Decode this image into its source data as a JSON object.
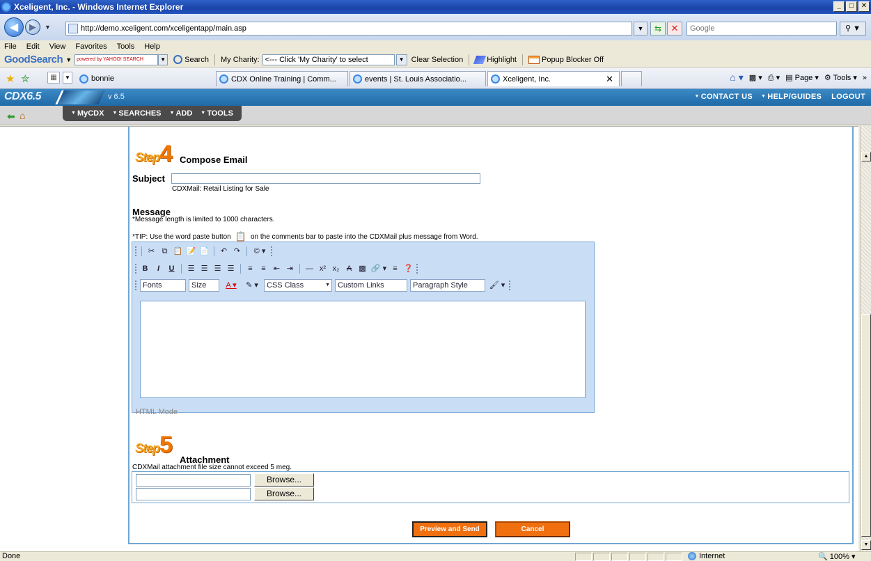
{
  "browser": {
    "window_title": "Xceligent, Inc. - Windows Internet Explorer",
    "url": "http://demo.xceligent.com/xceligentapp/main.asp",
    "search_placeholder": "Google",
    "menu": [
      "File",
      "Edit",
      "View",
      "Favorites",
      "Tools",
      "Help"
    ],
    "goodsearch": {
      "logo": "GoodSearch",
      "powered": "powered by YAHOO! SEARCH",
      "search_label": "Search",
      "charity_label": "My Charity:",
      "charity_value": "<--- Click 'My Charity' to select",
      "clear_label": "Clear Selection",
      "highlight_label": "Highlight",
      "popup_label": "Popup Blocker Off"
    },
    "favorite_link": "bonnie",
    "tabs": [
      {
        "label": "CDX Online Training | Comm..."
      },
      {
        "label": "events | St. Louis Associatio..."
      },
      {
        "label": "Xceligent, Inc."
      }
    ],
    "command_bar": {
      "page": "Page",
      "tools": "Tools"
    },
    "status": {
      "text": "Done",
      "zone": "Internet",
      "zoom": "100%"
    }
  },
  "cdx": {
    "logo": "CDX6.5",
    "version": "v 6.5",
    "top_links": [
      "CONTACT US",
      "HELP/GUIDES",
      "LOGOUT"
    ],
    "main_menu": [
      "MyCDX",
      "SEARCHES",
      "ADD",
      "TOOLS"
    ]
  },
  "form": {
    "step4": {
      "word": "Step",
      "number": "4",
      "title": "Compose Email"
    },
    "subject_label": "Subject",
    "subject_value": "",
    "subject_hint": "CDXMail: Retail Listing for Sale",
    "message_label": "Message",
    "message_limit": "*Message length is limited to 1000 characters.",
    "tip_before": "*TIP: Use the word paste button",
    "tip_after": "on the comments bar to paste into the CDXMail plus message from Word.",
    "editor": {
      "fonts": "Fonts",
      "size": "Size",
      "css_class": "CSS Class",
      "custom_links": "Custom Links",
      "paragraph_style": "Paragraph Style",
      "html_mode": "HTML Mode"
    },
    "step5": {
      "word": "Step",
      "number": "5",
      "title": "Attachment"
    },
    "attachment_note": "CDXMail attachment file size cannot exceed 5 meg.",
    "browse_label": "Browse...",
    "preview_button": "Preview and Send",
    "cancel_button": "Cancel"
  }
}
